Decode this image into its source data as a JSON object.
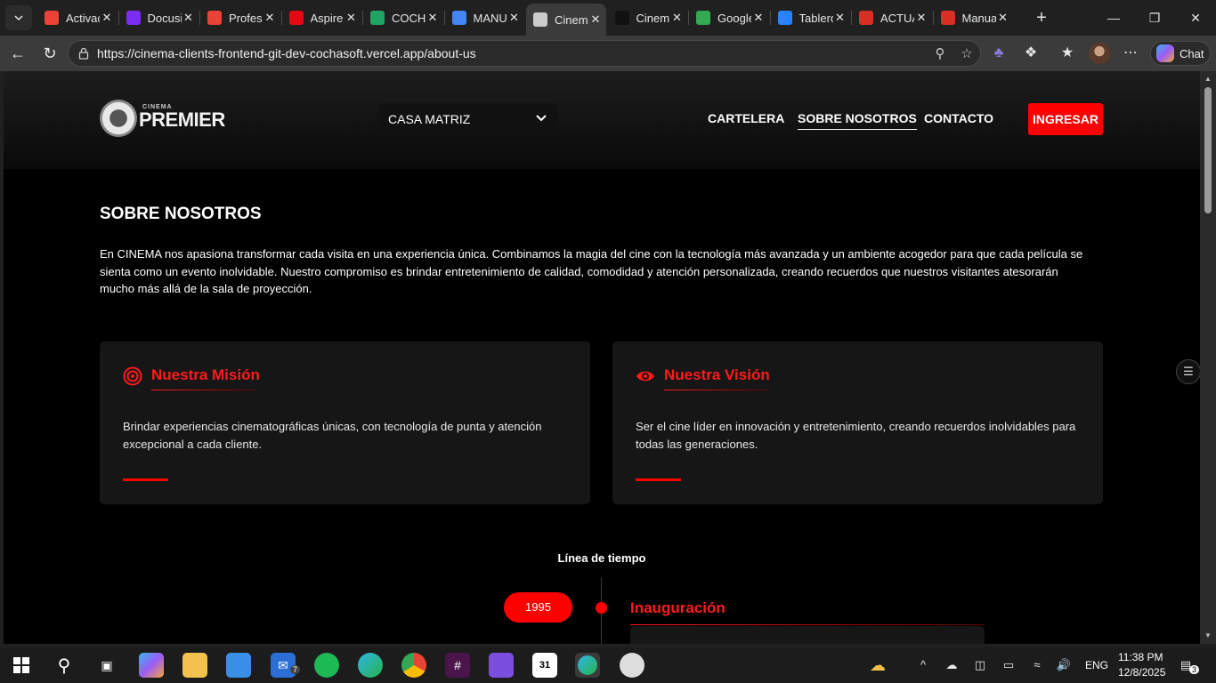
{
  "browser": {
    "tabs": [
      {
        "label": "Activac",
        "icon": "gmail-icon",
        "color": "#ea4335"
      },
      {
        "label": "Docusi",
        "icon": "docusign-icon",
        "color": "#7b2cf5"
      },
      {
        "label": "Profess",
        "icon": "gmail-icon",
        "color": "#ea4335"
      },
      {
        "label": "Aspire",
        "icon": "netflix-icon",
        "color": "#e50914"
      },
      {
        "label": "COCHA",
        "icon": "google-drive-icon",
        "color": "#1fa463"
      },
      {
        "label": "MANU",
        "icon": "google-docs-icon",
        "color": "#4285f4"
      },
      {
        "label": "Cinem",
        "icon": "cinema-icon",
        "color": "#cccccc",
        "active": true
      },
      {
        "label": "Cinem",
        "icon": "github-icon",
        "color": "#111111"
      },
      {
        "label": "Google",
        "icon": "google-icon",
        "color": "#34a853"
      },
      {
        "label": "Tablero",
        "icon": "jira-icon",
        "color": "#2684ff"
      },
      {
        "label": "ACTUA",
        "icon": "pdf-icon",
        "color": "#d93025"
      },
      {
        "label": "Manua",
        "icon": "pdf-icon",
        "color": "#d93025"
      }
    ],
    "url": "https://cinema-clients-frontend-git-dev-cochasoft.vercel.app/about-us",
    "chat_label": "Chat"
  },
  "site": {
    "logo_small": "CINEMA",
    "logo_big": "PREMIER",
    "branch": "CASA MATRIZ",
    "nav": {
      "cartelera": "CARTELERA",
      "sobre_nosotros": "SOBRE NOSOTROS",
      "contacto": "CONTACTO"
    },
    "login": "INGRESAR",
    "about": {
      "title": "SOBRE NOSOTROS",
      "text": "En CINEMA nos apasiona transformar cada visita en una experiencia única. Combinamos la magia del cine con la tecnología más avanzada y un ambiente acogedor para que cada película se sienta como un evento inolvidable. Nuestro compromiso es brindar entretenimiento de calidad, comodidad y atención personalizada, creando recuerdos que nuestros visitantes atesorarán mucho más allá de la sala de proyección."
    },
    "mission": {
      "title": "Nuestra Misión",
      "text": "Brindar experiencias cinematográficas únicas, con tecnología de punta y atención excepcional a cada cliente."
    },
    "vision": {
      "title": "Nuestra Visión",
      "text": "Ser el cine líder en innovación y entretenimiento, creando recuerdos inolvidables para todas las generaciones."
    },
    "timeline": {
      "title": "Línea de tiempo",
      "items": [
        {
          "year": "1995",
          "event": "Inauguración"
        }
      ]
    },
    "accent_color": "#ff0000"
  },
  "taskbar": {
    "time": "11:38 PM",
    "date": "12/8/2025",
    "lang": "ENG",
    "mail_badge": "7",
    "notif_badge": "3"
  }
}
